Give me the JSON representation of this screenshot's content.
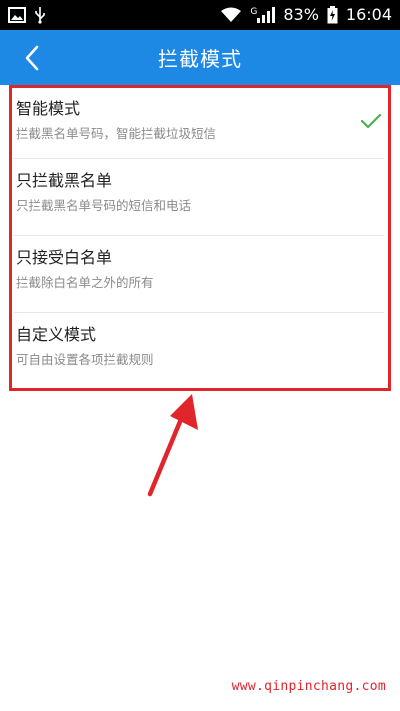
{
  "status_bar": {
    "battery": "83%",
    "time": "16:04",
    "signal_label": "G"
  },
  "app_bar": {
    "title": "拦截模式"
  },
  "modes": [
    {
      "title": "智能模式",
      "desc": "拦截黑名单号码，智能拦截垃圾短信",
      "selected": true
    },
    {
      "title": "只拦截黑名单",
      "desc": "只拦截黑名单号码的短信和电话",
      "selected": false
    },
    {
      "title": "只接受白名单",
      "desc": "拦截除白名单之外的所有",
      "selected": false
    },
    {
      "title": "自定义模式",
      "desc": "可自由设置各项拦截规则",
      "selected": false
    }
  ],
  "footer": {
    "url": "www.qinpinchang.com"
  },
  "colors": {
    "app_bar": "#1e88e5",
    "check": "#4caf50",
    "highlight": "#e0252b"
  }
}
